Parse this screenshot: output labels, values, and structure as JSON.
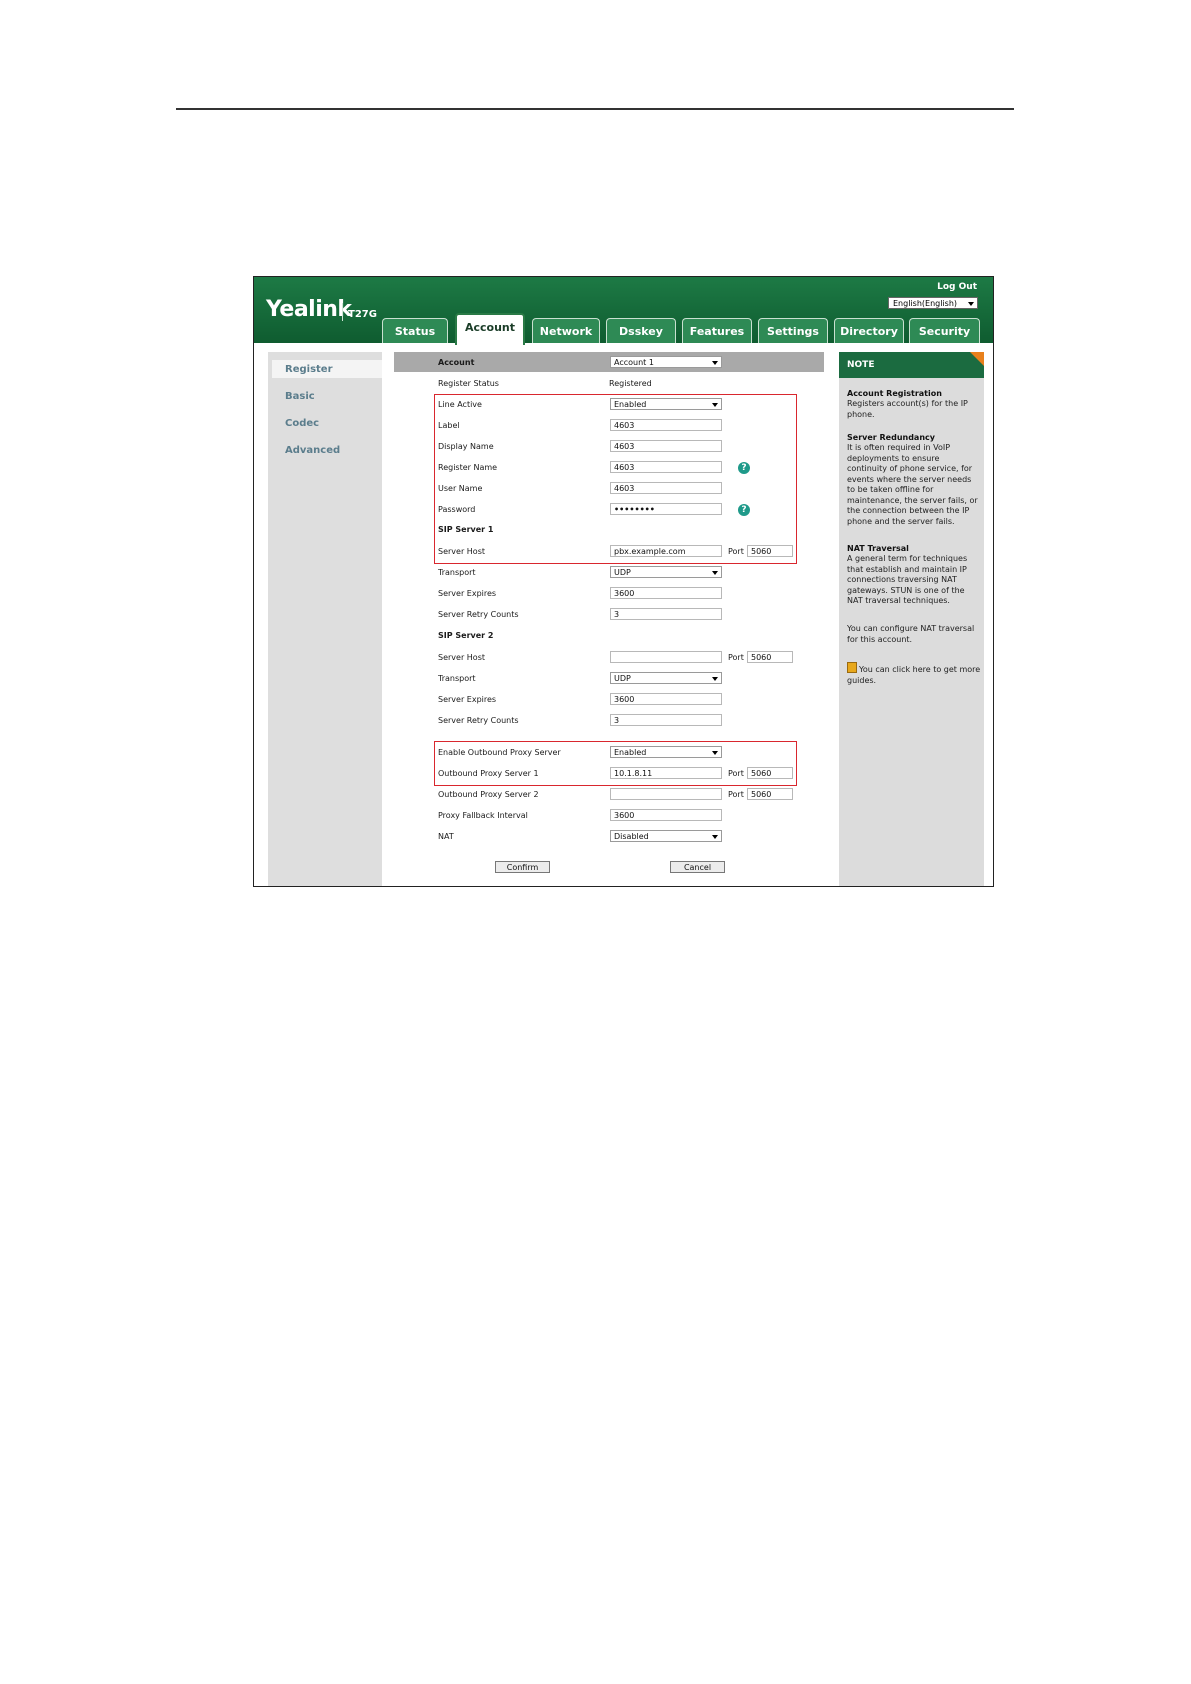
{
  "header": {
    "logo": "Yealink",
    "model": "T27G",
    "logout": "Log Out",
    "language": "English(English)"
  },
  "tabs": [
    "Status",
    "Account",
    "Network",
    "Dsskey",
    "Features",
    "Settings",
    "Directory",
    "Security"
  ],
  "active_tab": "Account",
  "sidebar": [
    "Register",
    "Basic",
    "Codec",
    "Advanced"
  ],
  "form": {
    "account_label": "Account",
    "account_value": "Account 1",
    "register_status_label": "Register Status",
    "register_status_value": "Registered",
    "line_active_label": "Line Active",
    "line_active_value": "Enabled",
    "label_label": "Label",
    "label_value": "4603",
    "display_name_label": "Display Name",
    "display_name_value": "4603",
    "register_name_label": "Register Name",
    "register_name_value": "4603",
    "user_name_label": "User Name",
    "user_name_value": "4603",
    "password_label": "Password",
    "password_value": "••••••••",
    "sip1_title": "SIP Server 1",
    "sip1_host_label": "Server Host",
    "sip1_host_value": "pbx.example.com",
    "port_label": "Port",
    "sip1_port_value": "5060",
    "sip1_transport_label": "Transport",
    "sip1_transport_value": "UDP",
    "sip1_expires_label": "Server Expires",
    "sip1_expires_value": "3600",
    "sip1_retry_label": "Server Retry Counts",
    "sip1_retry_value": "3",
    "sip2_title": "SIP Server 2",
    "sip2_host_label": "Server Host",
    "sip2_host_value": "",
    "sip2_port_value": "5060",
    "sip2_transport_label": "Transport",
    "sip2_transport_value": "UDP",
    "sip2_expires_label": "Server Expires",
    "sip2_expires_value": "3600",
    "sip2_retry_label": "Server Retry Counts",
    "sip2_retry_value": "3",
    "outbound_enable_label": "Enable Outbound Proxy Server",
    "outbound_enable_value": "Enabled",
    "outbound1_label": "Outbound Proxy Server 1",
    "outbound1_value": "10.1.8.11",
    "outbound1_port": "5060",
    "outbound2_label": "Outbound Proxy Server 2",
    "outbound2_value": "",
    "outbound2_port": "5060",
    "fallback_label": "Proxy Fallback Interval",
    "fallback_value": "3600",
    "nat_label": "NAT",
    "nat_value": "Disabled",
    "confirm": "Confirm",
    "cancel": "Cancel"
  },
  "note": {
    "title": "NOTE",
    "s1_title": "Account Registration",
    "s1_text": "Registers account(s) for the IP phone.",
    "s2_title": "Server Redundancy",
    "s2_text": "It is often required in VoIP deployments to ensure continuity of phone service, for events where the server needs to be taken offline for maintenance, the server fails, or the connection between the IP phone and the server fails.",
    "s3_title": "NAT Traversal",
    "s3_text": "A general term for techniques that establish and maintain IP connections traversing NAT gateways. STUN is one of the NAT traversal techniques.",
    "s4_text": "You can configure NAT traversal for this account.",
    "s5_text": "You can click here to get more guides."
  },
  "colors": {
    "header_green": "#1d7a45",
    "note_header": "#1b6b40",
    "highlight_red": "#d9272e",
    "sidebar_link": "#5b7d8c"
  }
}
